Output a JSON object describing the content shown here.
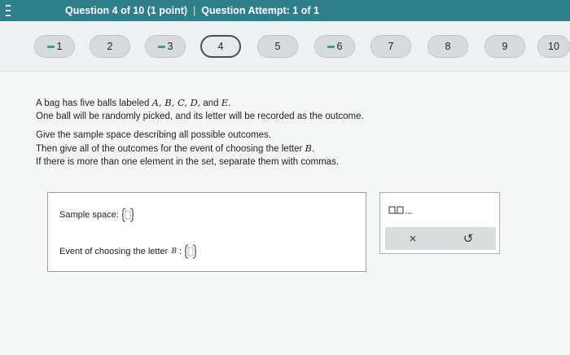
{
  "header": {
    "question_label": "Question 4 of 10",
    "points": "(1 point)",
    "separator": "|",
    "attempt": "Question Attempt: 1 of 1"
  },
  "nav": {
    "questions": [
      {
        "label": "1",
        "partial": true
      },
      {
        "label": "2",
        "partial": false
      },
      {
        "label": "3",
        "partial": true
      },
      {
        "label": "4",
        "partial": false,
        "current": true
      },
      {
        "label": "5",
        "partial": false
      },
      {
        "label": "6",
        "partial": true
      },
      {
        "label": "7",
        "partial": false
      },
      {
        "label": "8",
        "partial": false
      },
      {
        "label": "9",
        "partial": false
      },
      {
        "label": "10",
        "partial": false
      }
    ]
  },
  "prompt": {
    "line1_pre": "A bag has five balls labeled ",
    "line1_math": "A, B, C, D,",
    "line1_and": " and ",
    "line1_math2": "E",
    "line1_end": ".",
    "line2": "One ball will be randomly picked, and its letter will be recorded as the outcome.",
    "line3": "Give the sample space describing all possible outcomes.",
    "line4_pre": "Then give all of the outcomes for the event of choosing the letter ",
    "line4_math": "B",
    "line4_end": ".",
    "line5": "If there is more than one element in the set, separate them with commas."
  },
  "answers": {
    "sample_space_label": "Sample space:",
    "event_label": "Event of choosing the letter",
    "event_math": "B",
    "event_colon": ":"
  },
  "toolbox": {
    "set_icon": "set-braces-icon",
    "clear": "×",
    "undo": "↺"
  },
  "colors": {
    "header_bg": "#2f7f8a",
    "partial_indicator": "#3a9a8a"
  }
}
